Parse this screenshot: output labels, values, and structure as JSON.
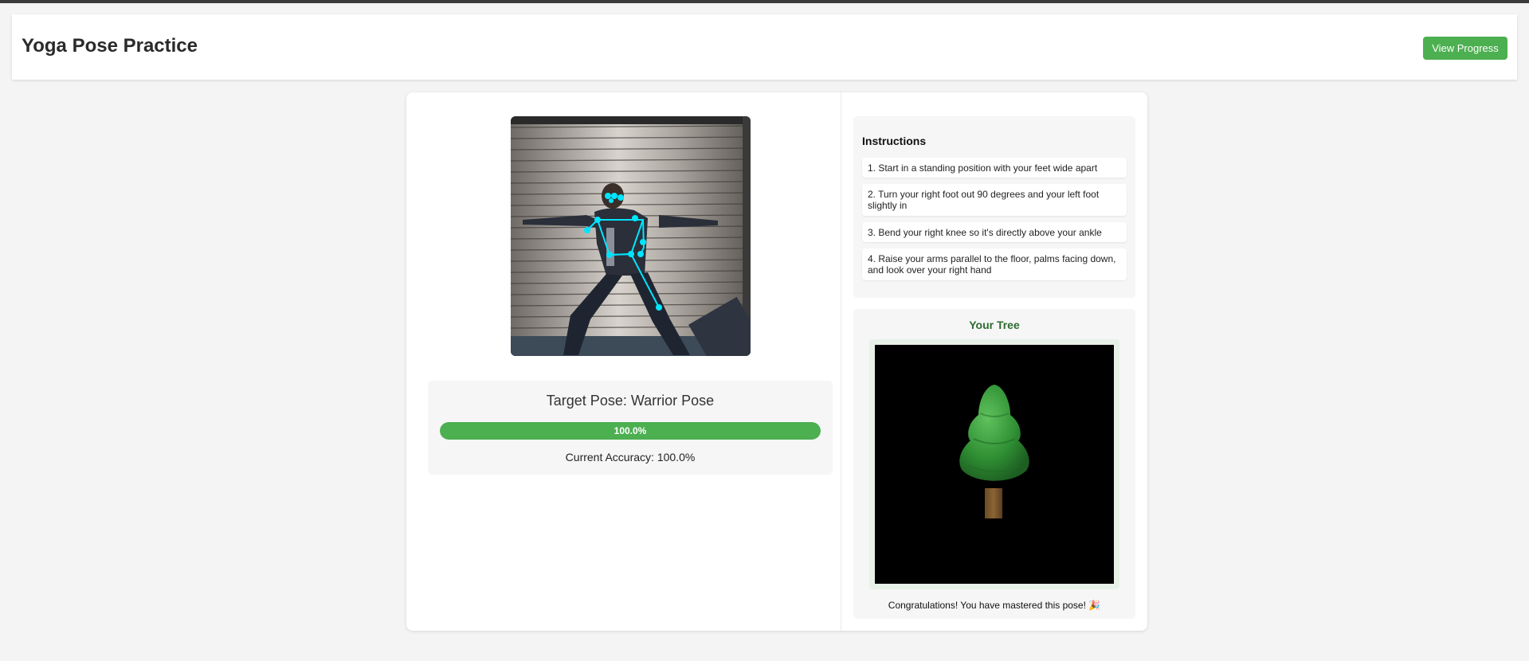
{
  "header": {
    "title": "Yoga Pose Practice",
    "view_progress_label": "View Progress"
  },
  "camera": {
    "description_icon": "webcam-feed-with-pose-skeleton",
    "skeleton_color": "#00e5ff"
  },
  "pose": {
    "target_label": "Target Pose: Warrior Pose",
    "progress": 1.0,
    "progress_text": "100.0%",
    "accuracy_text": "Current Accuracy: 100.0%"
  },
  "instructions": {
    "title": "Instructions",
    "items": [
      "1. Start in a standing position with your feet wide apart",
      "2. Turn your right foot out 90 degrees and your left foot slightly in",
      "3. Bend your right knee so it's directly above your ankle",
      "4. Raise your arms parallel to the floor, palms facing down, and look over your right hand"
    ]
  },
  "tree": {
    "title": "Your Tree",
    "congrats": "Congratulations! You have mastered this pose! 🎉"
  },
  "colors": {
    "accent": "#4caf50",
    "tree_title": "#2e6b2f",
    "page_bg": "#f4f4f4"
  }
}
